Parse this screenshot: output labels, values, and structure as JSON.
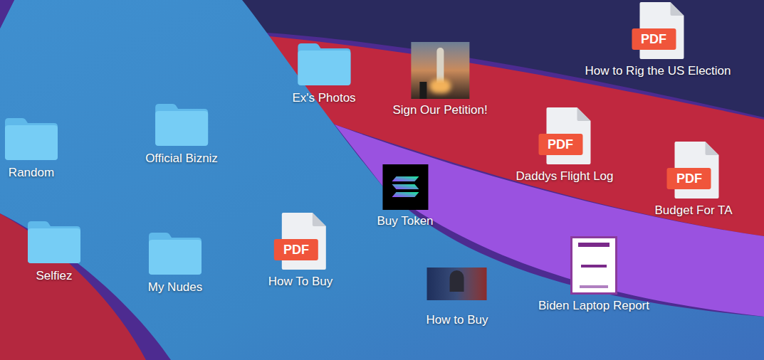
{
  "desktop": {
    "icons": [
      {
        "label": "Random",
        "kind": "folder"
      },
      {
        "label": "Official Bizniz",
        "kind": "folder"
      },
      {
        "label": "Ex's Photos",
        "kind": "folder"
      },
      {
        "label": "Sign Our Petition!",
        "kind": "poster"
      },
      {
        "label": "How to Rig the US Election",
        "kind": "pdf",
        "badge": "PDF"
      },
      {
        "label": "Daddys Flight Log",
        "kind": "pdf",
        "badge": "PDF"
      },
      {
        "label": "Budget For TA",
        "kind": "pdf",
        "badge": "PDF"
      },
      {
        "label": "Buy Token",
        "kind": "token"
      },
      {
        "label": "Selfiez",
        "kind": "folder"
      },
      {
        "label": "My Nudes",
        "kind": "folder"
      },
      {
        "label": "How To Buy",
        "kind": "pdf",
        "badge": "PDF"
      },
      {
        "label": "How to Buy",
        "kind": "video"
      },
      {
        "label": "Biden Laptop Report",
        "kind": "report"
      }
    ]
  }
}
